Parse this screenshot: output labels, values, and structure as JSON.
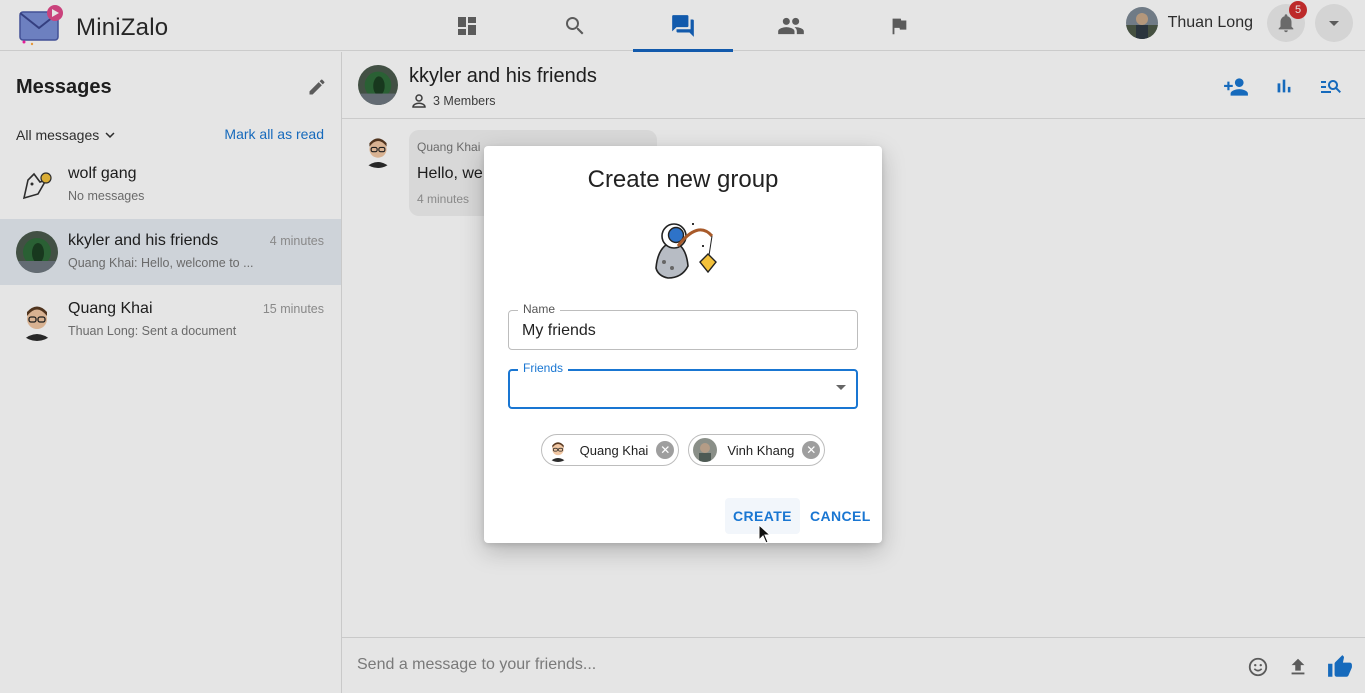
{
  "app": {
    "name": "MiniZalo"
  },
  "nav": {
    "tabs": [
      {
        "name": "dashboard",
        "icon": "dashboard-icon"
      },
      {
        "name": "search",
        "icon": "search-icon"
      },
      {
        "name": "messages",
        "icon": "chat-icon",
        "active": true
      },
      {
        "name": "friends",
        "icon": "people-icon"
      },
      {
        "name": "reports",
        "icon": "flag-icon"
      }
    ]
  },
  "user": {
    "name": "Thuan Long",
    "notification_count": "5"
  },
  "sidebar": {
    "title": "Messages",
    "filter_label": "All messages",
    "mark_all_label": "Mark all as read",
    "conversations": [
      {
        "name": "wolf gang",
        "preview": "No messages",
        "time": ""
      },
      {
        "name": "kkyler and his friends",
        "preview": "Quang Khai: Hello, welcome to ...",
        "time": "4 minutes",
        "active": true
      },
      {
        "name": "Quang Khai",
        "preview": "Thuan Long: Sent a document",
        "time": "15 minutes"
      }
    ]
  },
  "chat": {
    "title": "kkyler and his friends",
    "members": "3 Members",
    "message": {
      "sender": "Quang Khai",
      "text": "Hello, we",
      "time": "4 minutes"
    },
    "composer_placeholder": "Send a message to your friends..."
  },
  "dialog": {
    "title": "Create new group",
    "name_label": "Name",
    "name_value": "My friends",
    "friends_label": "Friends",
    "chips": [
      {
        "label": "Quang Khai"
      },
      {
        "label": "Vinh Khang"
      }
    ],
    "create_label": "CREATE",
    "cancel_label": "CANCEL"
  },
  "colors": {
    "accent": "#1976d2",
    "badge": "#d32f2f",
    "active_row": "#e6ebf2"
  }
}
